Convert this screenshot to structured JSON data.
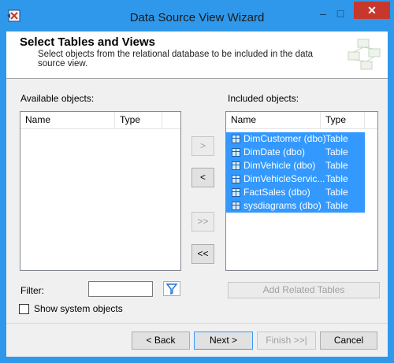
{
  "window": {
    "title": "Data Source View Wizard",
    "minimize_label": "–",
    "maximize_label": "□",
    "close_label": "✕"
  },
  "header": {
    "title": "Select Tables and Views",
    "description": "Select objects from the relational database to be included in the data source view."
  },
  "available": {
    "label": "Available objects:",
    "columns": [
      "Name",
      "Type"
    ],
    "rows": []
  },
  "included": {
    "label": "Included objects:",
    "columns": [
      "Name",
      "Type"
    ],
    "rows": [
      {
        "name": "DimCustomer (dbo)",
        "type": "Table"
      },
      {
        "name": "DimDate (dbo)",
        "type": "Table"
      },
      {
        "name": "DimVehicle (dbo)",
        "type": "Table"
      },
      {
        "name": "DimVehicleServic...",
        "type": "Table"
      },
      {
        "name": "FactSales (dbo)",
        "type": "Table"
      },
      {
        "name": "sysdiagrams (dbo)",
        "type": "Table"
      }
    ]
  },
  "transfer": {
    "add_one": ">",
    "remove_one": "<",
    "add_all": ">>",
    "remove_all": "<<"
  },
  "filter": {
    "label": "Filter:",
    "value": ""
  },
  "show_system": {
    "label": "Show system objects",
    "checked": false
  },
  "add_related_label": "Add Related Tables",
  "footer": {
    "back": "< Back",
    "next": "Next >",
    "finish": "Finish >>|",
    "cancel": "Cancel"
  },
  "colors": {
    "title_bar": "#2f98ea",
    "close_button": "#c7372c",
    "selection": "#3399ff"
  }
}
